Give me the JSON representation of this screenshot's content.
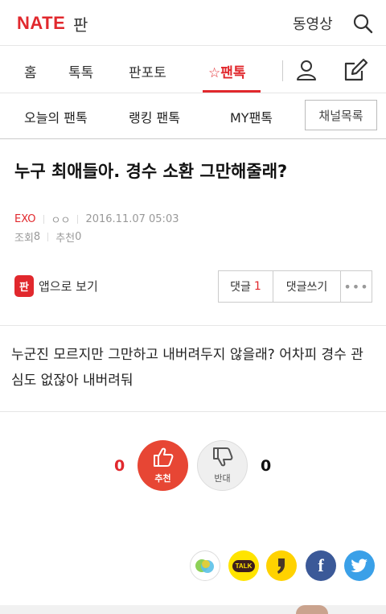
{
  "header": {
    "logo": "NATE",
    "logo_suffix": "판",
    "video_label": "동영상",
    "search_icon": "search-icon"
  },
  "nav": {
    "items": [
      {
        "label": "홈"
      },
      {
        "label": "톡톡"
      },
      {
        "label": "판포토"
      },
      {
        "label": "☆팬톡",
        "active": true
      }
    ],
    "user_icon": "user-icon",
    "write_icon": "pencil-icon"
  },
  "subnav": {
    "items": [
      {
        "label": "오늘의 팬톡"
      },
      {
        "label": "랭킹 팬톡"
      },
      {
        "label": "MY팬톡"
      }
    ],
    "channel_button": "채널목록"
  },
  "post": {
    "title": "누구 최애들아. 경수 소환 그만해줄래?",
    "category": "EXO",
    "author": "ㅇㅇ",
    "date": "2016.11.07 05:03",
    "views_label": "조회",
    "views": "8",
    "recommend_label": "추천",
    "recommend": "0",
    "app_icon_text": "판",
    "app_view_label": "앱으로 보기",
    "comment_label": "댓글",
    "comment_count": "1",
    "write_comment_label": "댓글쓰기",
    "more_label": "•••",
    "body": "누군진 모르지만 그만하고 내버려두지 않을래? 어차피 경수 관심도 없잖아 내버려둬"
  },
  "votes": {
    "up_count": "0",
    "up_label": "추천",
    "down_count": "0",
    "down_label": "반대"
  },
  "share": {
    "talk_text": "TALK",
    "facebook_text": "f"
  },
  "colors": {
    "accent": "#e1282d",
    "vote_up": "#e74634",
    "kakao": "#ffe400",
    "facebook": "#3b5998",
    "twitter": "#3aa0e8"
  }
}
